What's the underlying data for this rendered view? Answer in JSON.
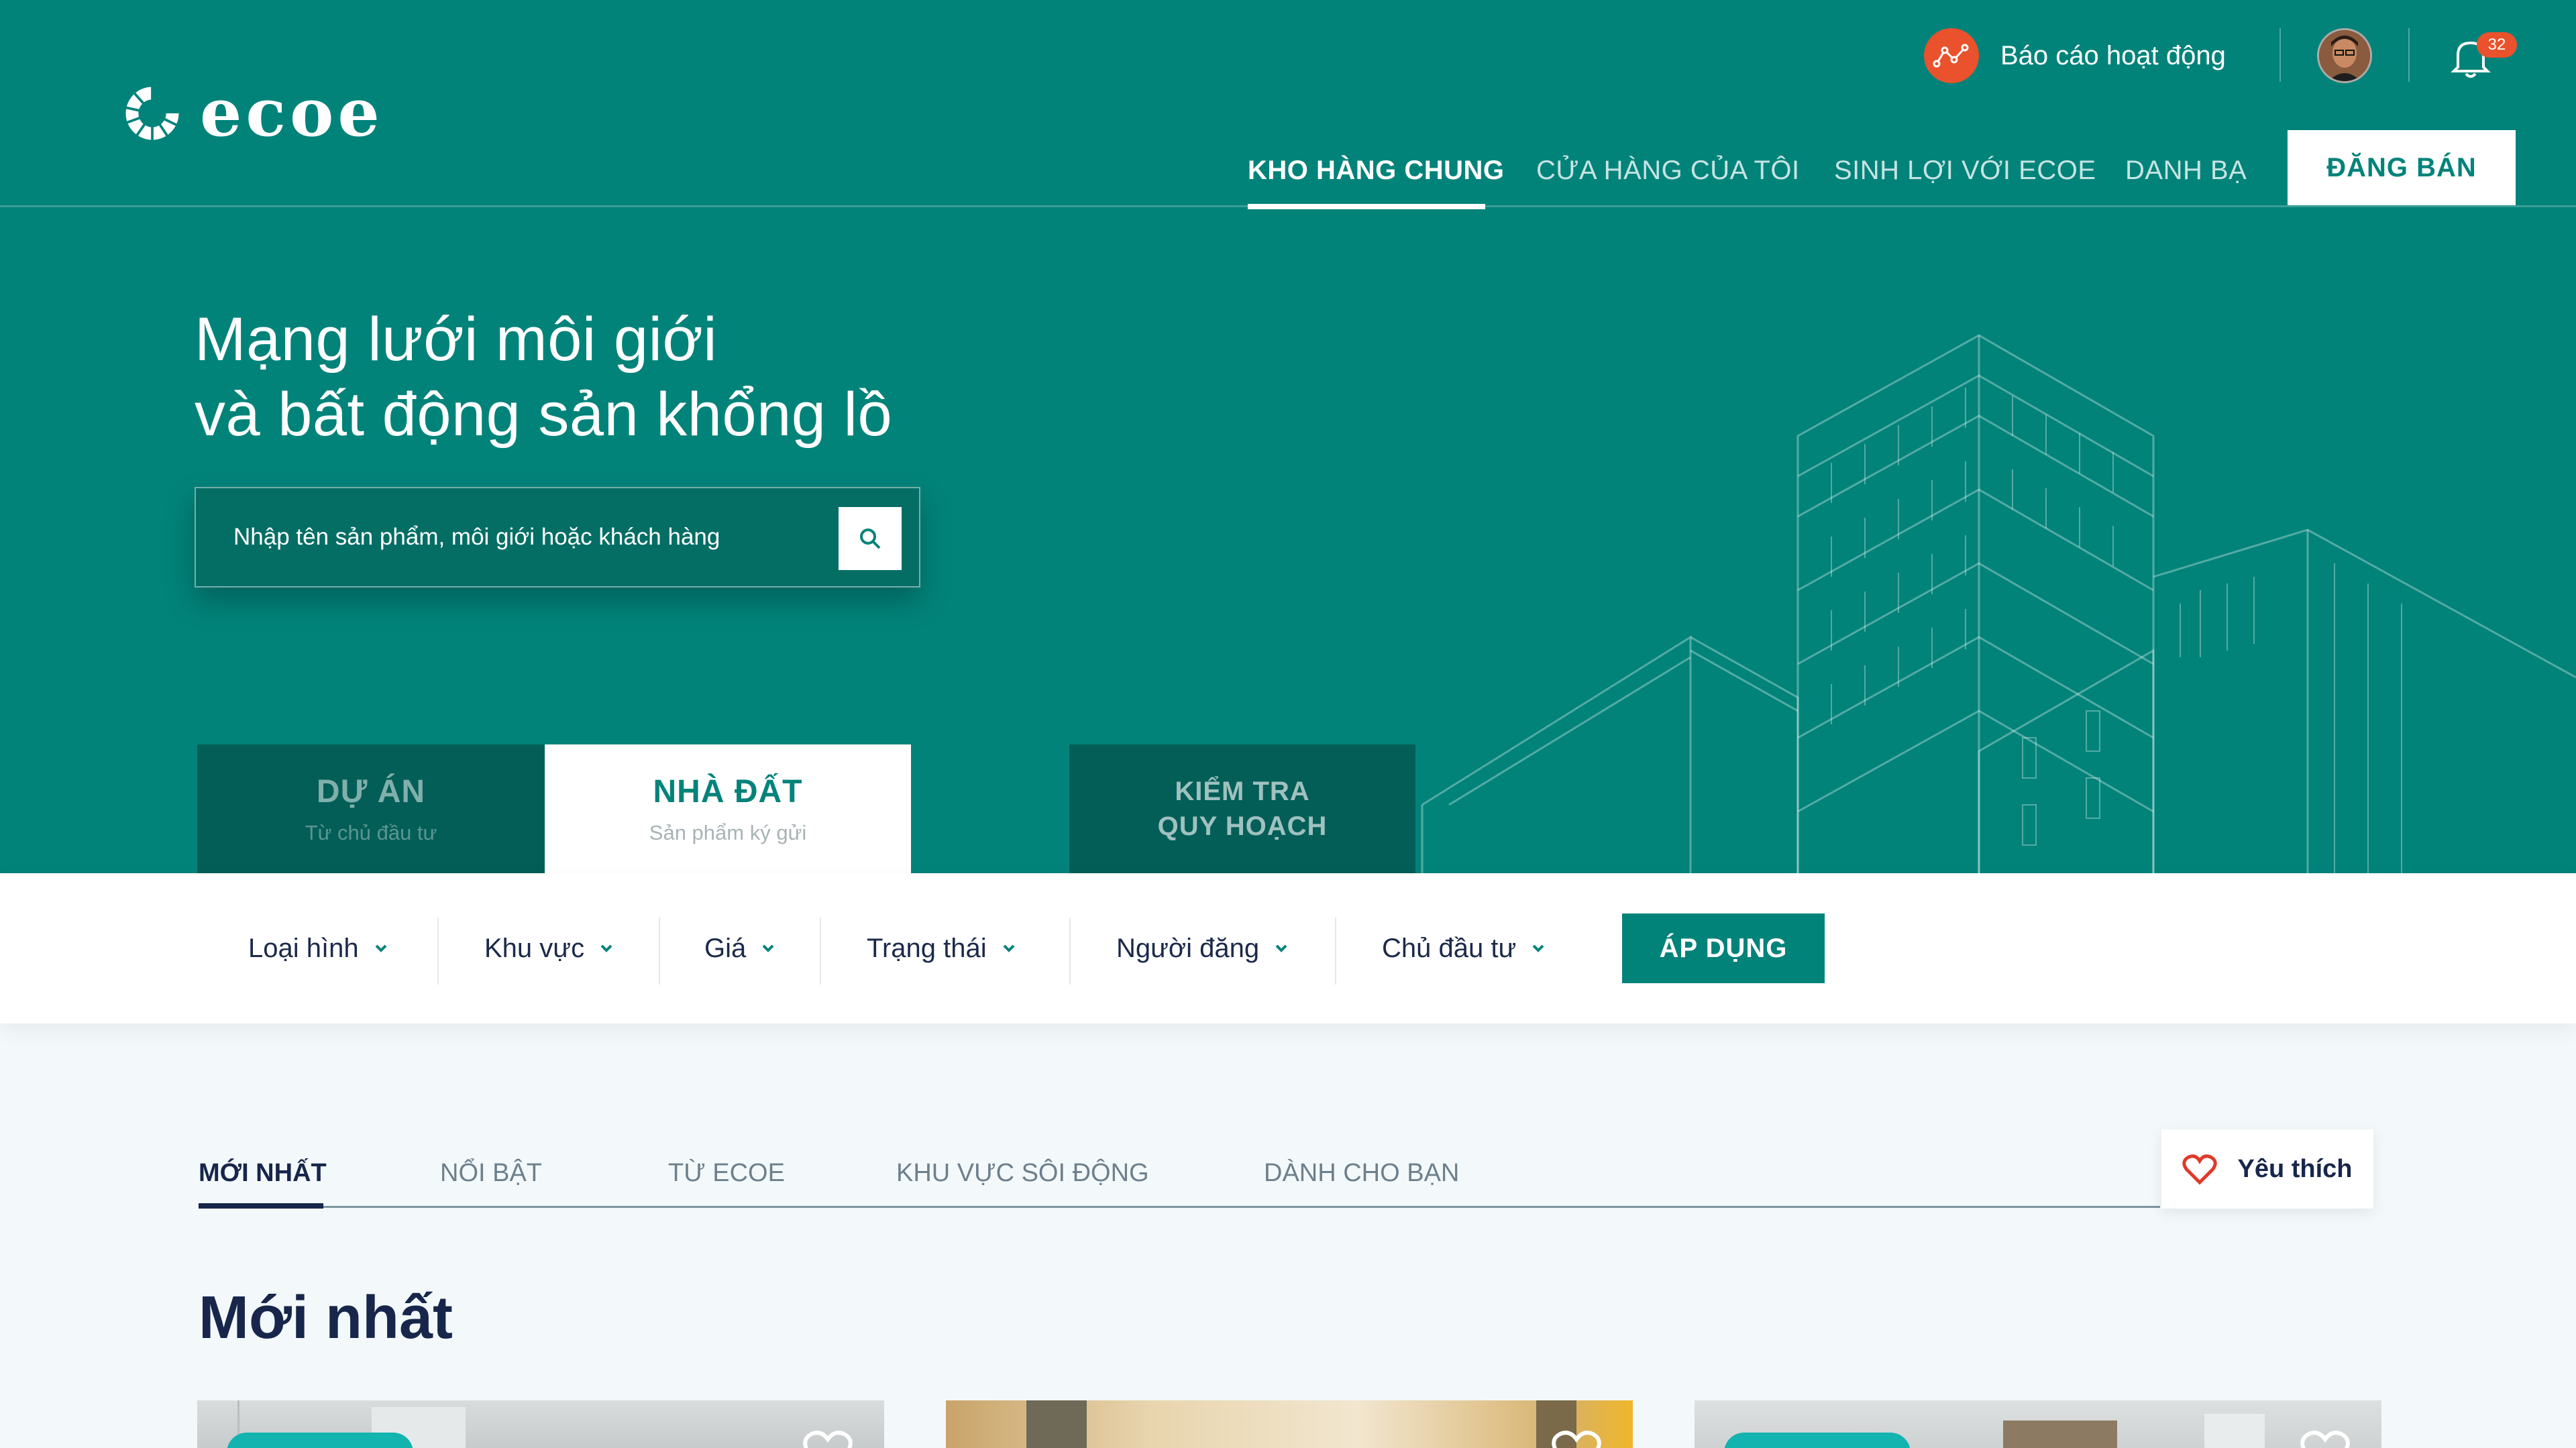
{
  "brand": {
    "name": "ecoe"
  },
  "colors": {
    "primary": "#02837a",
    "dark_teal": "#035e57",
    "accent": "#e9522c",
    "navy": "#17264a"
  },
  "header": {
    "report_label": "Báo cáo hoạt động",
    "notification_count": "32",
    "nav": [
      {
        "label": "KHO HÀNG CHUNG",
        "active": true
      },
      {
        "label": "CỬA HÀNG CỦA TÔI",
        "active": false
      },
      {
        "label": "SINH LỢI VỚI ECOE",
        "active": false
      },
      {
        "label": "DANH BẠ",
        "active": false
      }
    ],
    "post_button": "ĐĂNG BÁN"
  },
  "hero": {
    "title_line1": "Mạng lưới môi giới",
    "title_line2": "và bất động sản khổng lồ",
    "search_placeholder": "Nhập tên sản phẩm, môi giới hoặc khách hàng"
  },
  "category_tabs": [
    {
      "title": "DỰ ÁN",
      "subtitle": "Từ chủ đầu tư",
      "active": false
    },
    {
      "title": "NHÀ ĐẤT",
      "subtitle": "Sản phẩm ký gửi",
      "active": true
    }
  ],
  "planning_check": {
    "line1": "KIỂM TRA",
    "line2": "QUY HOẠCH"
  },
  "filters": [
    {
      "label": "Loại hình"
    },
    {
      "label": "Khu vực"
    },
    {
      "label": "Giá"
    },
    {
      "label": "Trạng thái"
    },
    {
      "label": "Người đăng"
    },
    {
      "label": "Chủ đầu tư"
    }
  ],
  "apply_button": "ÁP DỤNG",
  "content_tabs": [
    {
      "label": "MỚI NHẤT",
      "active": true
    },
    {
      "label": "NỔI BẬT",
      "active": false
    },
    {
      "label": "TỪ ECOE",
      "active": false
    },
    {
      "label": "KHU VỰC SÔI ĐỘNG",
      "active": false
    },
    {
      "label": "DÀNH CHO BẠN",
      "active": false
    }
  ],
  "favorites_label": "Yêu thích",
  "section_title": "Mới nhất",
  "listing_cards": [
    {
      "icon": "heart-icon"
    },
    {
      "icon": "heart-icon"
    },
    {
      "icon": "heart-icon"
    }
  ]
}
